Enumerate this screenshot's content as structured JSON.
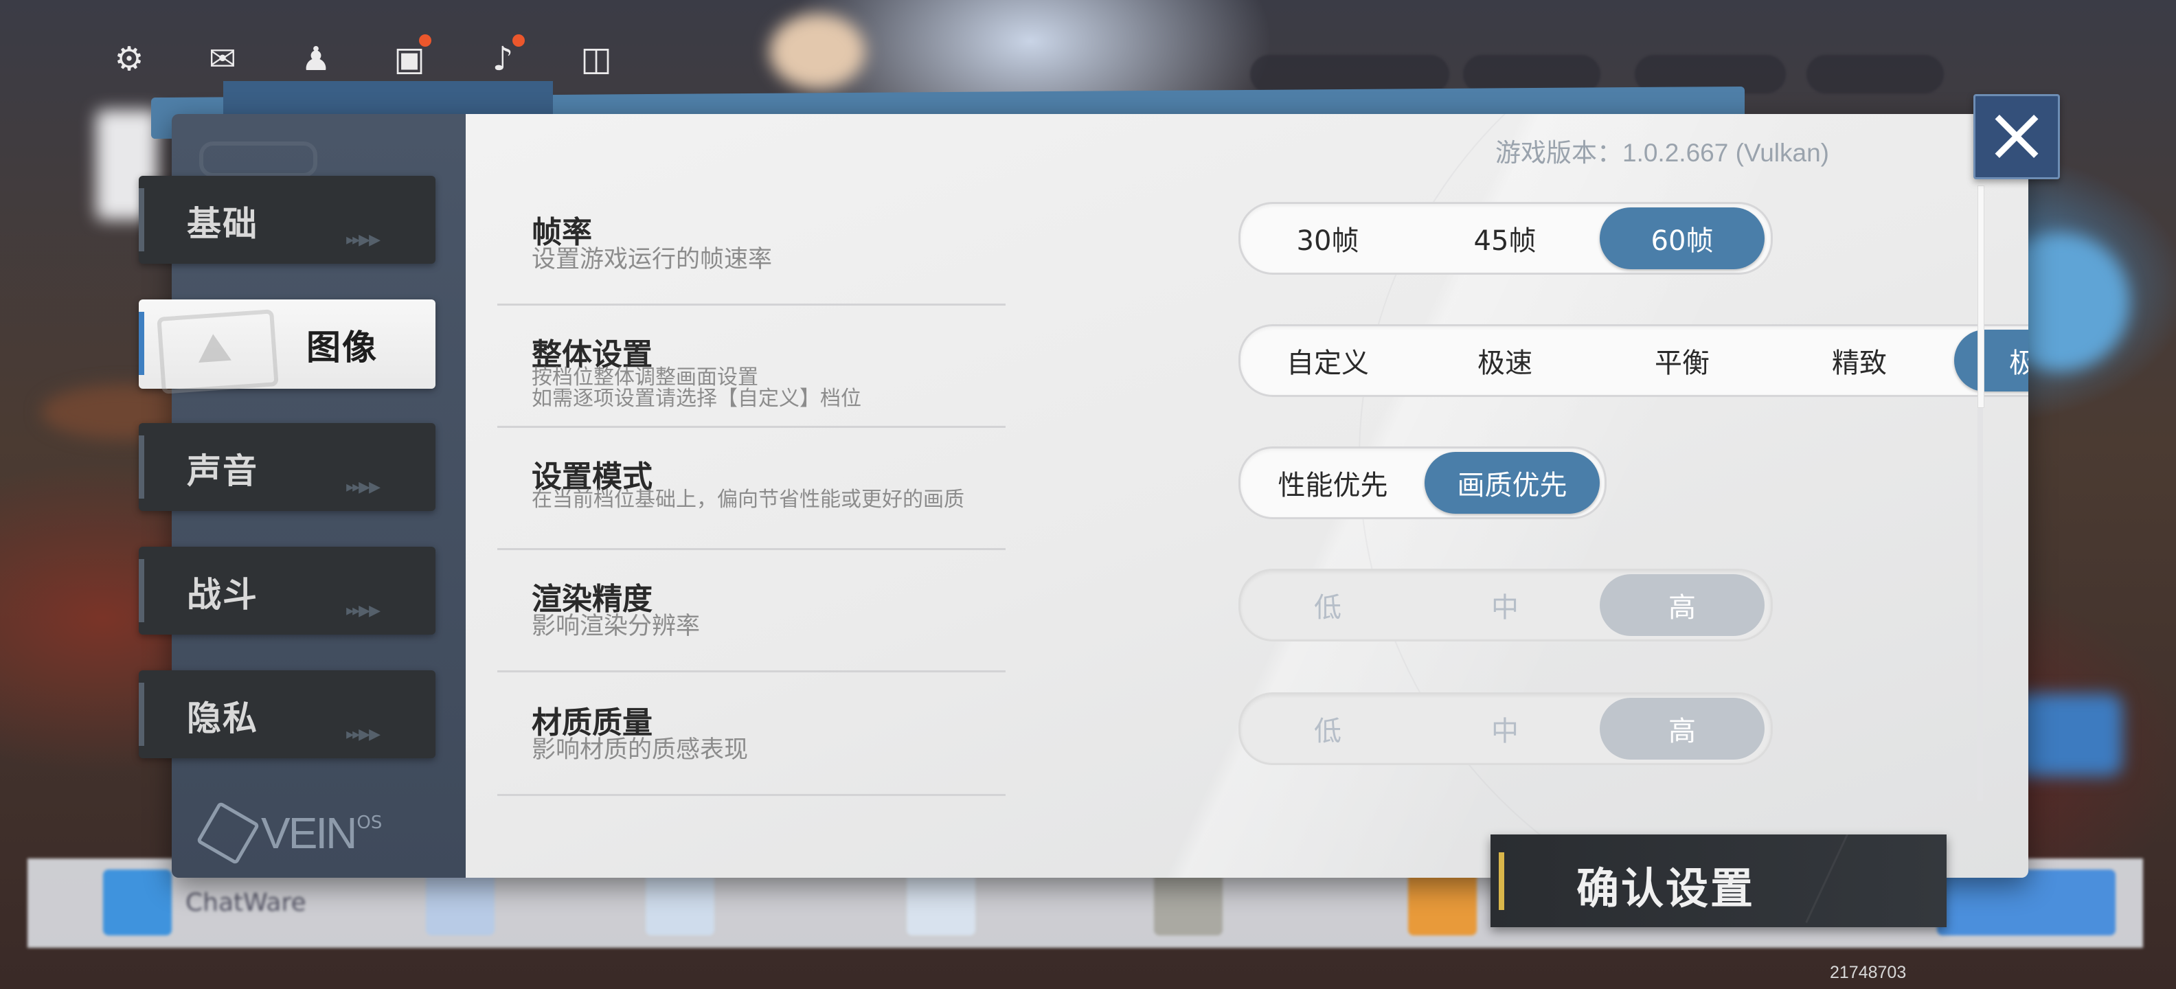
{
  "version_text": "游戏版本：1.0.2.667 (Vulkan)",
  "nav": {
    "basic": "基础",
    "graphics": "图像",
    "sound": "声音",
    "battle": "战斗",
    "privacy": "隐私",
    "active": "图像"
  },
  "logo": {
    "text": "VEIN",
    "sup": "OS"
  },
  "settings": {
    "framerate": {
      "title": "帧率",
      "desc": "设置游戏运行的帧速率",
      "options": [
        "30帧",
        "45帧",
        "60帧"
      ],
      "selected": "60帧"
    },
    "overall": {
      "title": "整体设置",
      "desc_line1": "按档位整体调整画面设置",
      "desc_line2": "如需逐项设置请选择【自定义】档位",
      "options": [
        "自定义",
        "极速",
        "平衡",
        "精致",
        "极佳"
      ],
      "selected": "极佳"
    },
    "mode": {
      "title": "设置模式",
      "desc": "在当前档位基础上，偏向节省性能或更好的画质",
      "options": [
        "性能优先",
        "画质优先"
      ],
      "selected": "画质优先"
    },
    "render": {
      "title": "渲染精度",
      "desc": "影响渲染分辨率",
      "options": [
        "低",
        "中",
        "高"
      ],
      "selected": "高"
    },
    "material": {
      "title": "材质质量",
      "desc": "影响材质的质感表现",
      "options": [
        "低",
        "中",
        "高"
      ],
      "selected": "高"
    }
  },
  "confirm_label": "确认设置",
  "bottom_bar": {
    "chat_label": "ChatWare",
    "id_number": "21748703"
  },
  "colors": {
    "accent": "#4a7ea9",
    "close_bg": "#34507a",
    "confirm_accent": "#d9b64a",
    "sidebar": "#4a5668"
  }
}
